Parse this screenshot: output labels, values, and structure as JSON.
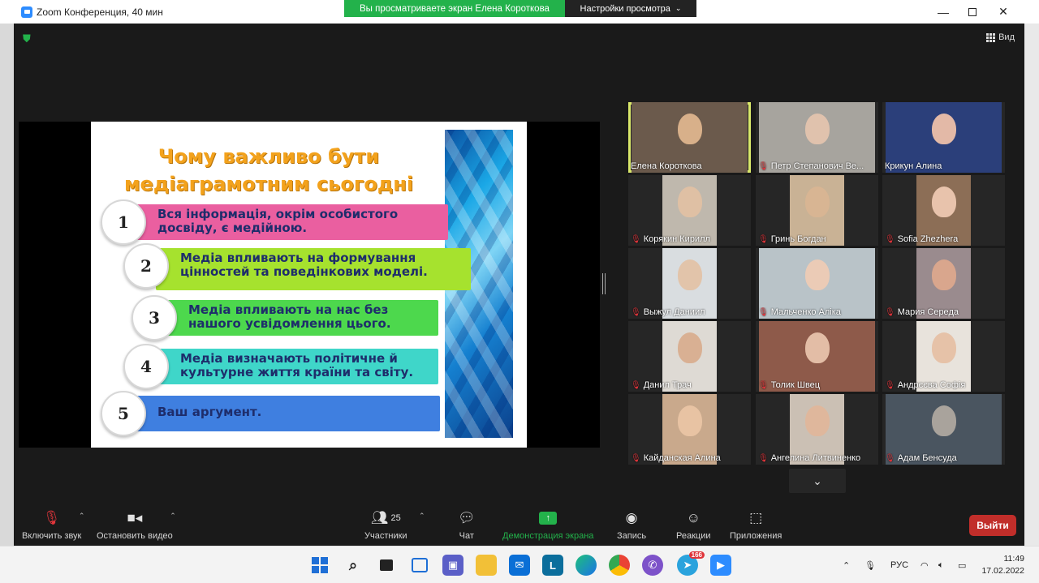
{
  "window": {
    "title": "Zoom Конференция, 40 мин",
    "share_banner": "Вы просматриваете экран Елена Короткова",
    "view_settings": "Настройки просмотра",
    "view_label": "Вид"
  },
  "slide": {
    "title_line1": "Чому важливо бути",
    "title_line2": "медіаграмотним сьогодні",
    "items": [
      {
        "num": "1",
        "text": "Вся інформація, окрім особистого досвіду, є медійною.",
        "color": "#ea5fa0"
      },
      {
        "num": "2",
        "text": "Медіа впливають на формування цінностей та поведінкових моделі.",
        "color": "#a6e22e"
      },
      {
        "num": "3",
        "text": "Медіа впливають на нас без нашого усвідомлення цього.",
        "color": "#4dd84d"
      },
      {
        "num": "4",
        "text": "Медіа визначають політичне й культурне життя країни та світу.",
        "color": "#3fd6c9"
      },
      {
        "num": "5",
        "text": "Ваш аргумент.",
        "color": "#3f7fe0"
      }
    ]
  },
  "participants": [
    {
      "name": "Елена Короткова",
      "muted": false,
      "bg": "#6b5a4c",
      "face": "#d8b08a"
    },
    {
      "name": "Петр Степанович Ве...",
      "muted": true,
      "bg": "#a7a49e",
      "face": "#e0c2ad"
    },
    {
      "name": "Крикун Алина",
      "muted": false,
      "bg": "#2b3f7a",
      "face": "#e3b9a7"
    },
    {
      "name": "Корякин Кирилл",
      "muted": true,
      "bg": "#bfb8ad",
      "face": "#dfc0a4"
    },
    {
      "name": "Гринь Богдан",
      "muted": true,
      "bg": "#c9b295",
      "face": "#d8b593"
    },
    {
      "name": "Sofia Zhezhera",
      "muted": true,
      "bg": "#8c6e56",
      "face": "#e8c3ac"
    },
    {
      "name": "Выжул Даниил",
      "muted": true,
      "bg": "#d9dde0",
      "face": "#e2c4aa"
    },
    {
      "name": "Мальченко Аліка",
      "muted": true,
      "bg": "#b9c3c8",
      "face": "#ebcbb6"
    },
    {
      "name": "Мария Середа",
      "muted": true,
      "bg": "#9a8b8e",
      "face": "#d9a68d"
    },
    {
      "name": "Данил Трач",
      "muted": true,
      "bg": "#dedad4",
      "face": "#d9b093"
    },
    {
      "name": "Толик Швец",
      "muted": true,
      "bg": "#8e5a4a",
      "face": "#e3bda6"
    },
    {
      "name": "Андрєєва Софія",
      "muted": true,
      "bg": "#e8e3dc",
      "face": "#e6c2a8"
    },
    {
      "name": "Кайданская Алина",
      "muted": true,
      "bg": "#c9a98c",
      "face": "#e8c3a3"
    },
    {
      "name": "Ангелина Литвиненко",
      "muted": true,
      "bg": "#cbc0b4",
      "face": "#dfb79c"
    },
    {
      "name": "Адам Бенсуда",
      "muted": true,
      "bg": "#4a5560",
      "face": "#a9a39c"
    }
  ],
  "toolbar": {
    "mute": "Включить звук",
    "video": "Остановить видео",
    "participants": "Участники",
    "participants_count": "25",
    "chat": "Чат",
    "share": "Демонстрация экрана",
    "record": "Запись",
    "reactions": "Реакции",
    "apps": "Приложения",
    "leave": "Выйти"
  },
  "taskbar": {
    "language": "РУС",
    "time": "11:49",
    "date": "17.02.2022",
    "telegram_badge": "166"
  },
  "colors": {
    "accent_green": "#23b24b",
    "leave_red": "#c12e2a",
    "active_speaker": "#d9e86a"
  }
}
